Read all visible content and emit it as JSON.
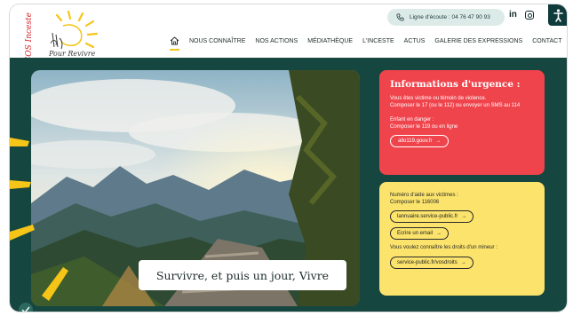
{
  "logo": {
    "vertical_text": "SOS Inceste",
    "name": "Pour Revivre"
  },
  "hotline": {
    "label": "Ligne d'écoute : 04 76 47 90 93"
  },
  "social": {
    "linkedin": "in"
  },
  "nav": {
    "items": [
      {
        "label": "NOUS CONNAÎTRE"
      },
      {
        "label": "NOS ACTIONS"
      },
      {
        "label": "MÉDIATHÈQUE"
      },
      {
        "label": "L'INCESTE"
      },
      {
        "label": "ACTUS"
      },
      {
        "label": "GALERIE DES EXPRESSIONS"
      },
      {
        "label": "CONTACT"
      }
    ]
  },
  "hero": {
    "caption": "Survivre, et puis un jour, Vivre"
  },
  "urgence": {
    "title": "Informations d'urgence :",
    "line1": "Vous êtes victime ou témoin de violence.",
    "line2": "Composer le 17 (ou le 112) ou envoyer un SMS au 114",
    "line3": "Enfant en danger :",
    "line4": "Composer le 119 ou en ligne",
    "link": "allo119.gouv.fr"
  },
  "aide": {
    "line1": "Numéro d'aide aux victimes :",
    "line2": "Composer le 116006",
    "link1": "lannuaire.service-public.fr",
    "link2": "Ecrire un email",
    "line3": "Vous voulez connaître les droits d'un mineur :",
    "link3": "service-public.fr/vosdroits"
  },
  "colors": {
    "teal": "#164640",
    "red": "#f0444d",
    "yellow": "#fbe36c",
    "accent": "#f2c41f"
  },
  "icons": [
    "phone-icon",
    "linkedin-icon",
    "instagram-icon",
    "accessibility-icon",
    "home-icon",
    "arrow-right-icon"
  ]
}
